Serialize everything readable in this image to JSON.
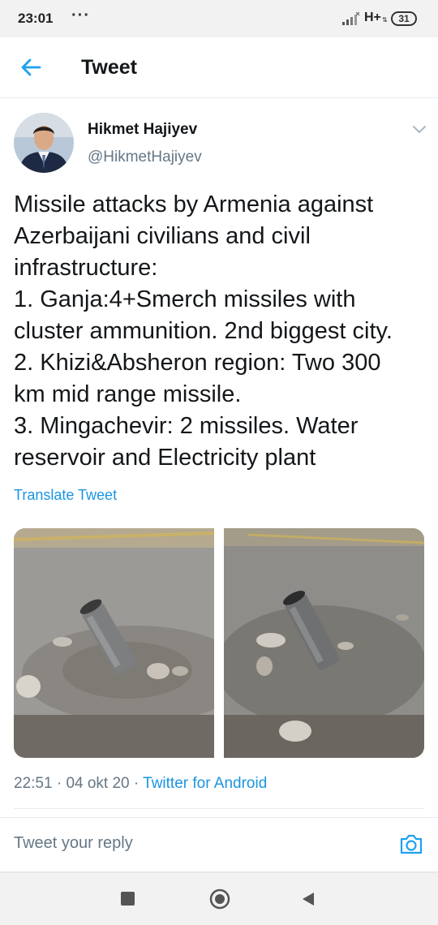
{
  "status_bar": {
    "time": "23:01",
    "dots": "···",
    "network": "H+",
    "battery": "31"
  },
  "header": {
    "title": "Tweet"
  },
  "tweet": {
    "author_name": "Hikmet Hajiyev",
    "author_handle": "@HikmetHajiyev",
    "text_lines": [
      "Missile attacks by Armenia against",
      "Azerbaijani civilians and civil",
      "infrastructure:",
      "1. Ganja:4+Smerch missiles with",
      "cluster ammunition. 2nd biggest city.",
      "2. Khizi&Absheron region: Two 300",
      "km mid range missile.",
      "3. Mingachevir: 2 missiles. Water",
      "reservoir and Electricity plant"
    ],
    "translate_label": "Translate Tweet",
    "time": "22:51",
    "date": "04 okt 20",
    "separator": " · ",
    "source": "Twitter for Android"
  },
  "reply": {
    "placeholder": "Tweet your reply"
  },
  "icons": {
    "back": "back-arrow-icon",
    "more": "chevron-down-icon",
    "camera": "camera-icon",
    "nav_recent": "square-icon",
    "nav_home": "circle-icon",
    "nav_back": "triangle-back-icon"
  },
  "colors": {
    "accent": "#1b95e0",
    "text": "#14171a",
    "secondary": "#657786"
  }
}
